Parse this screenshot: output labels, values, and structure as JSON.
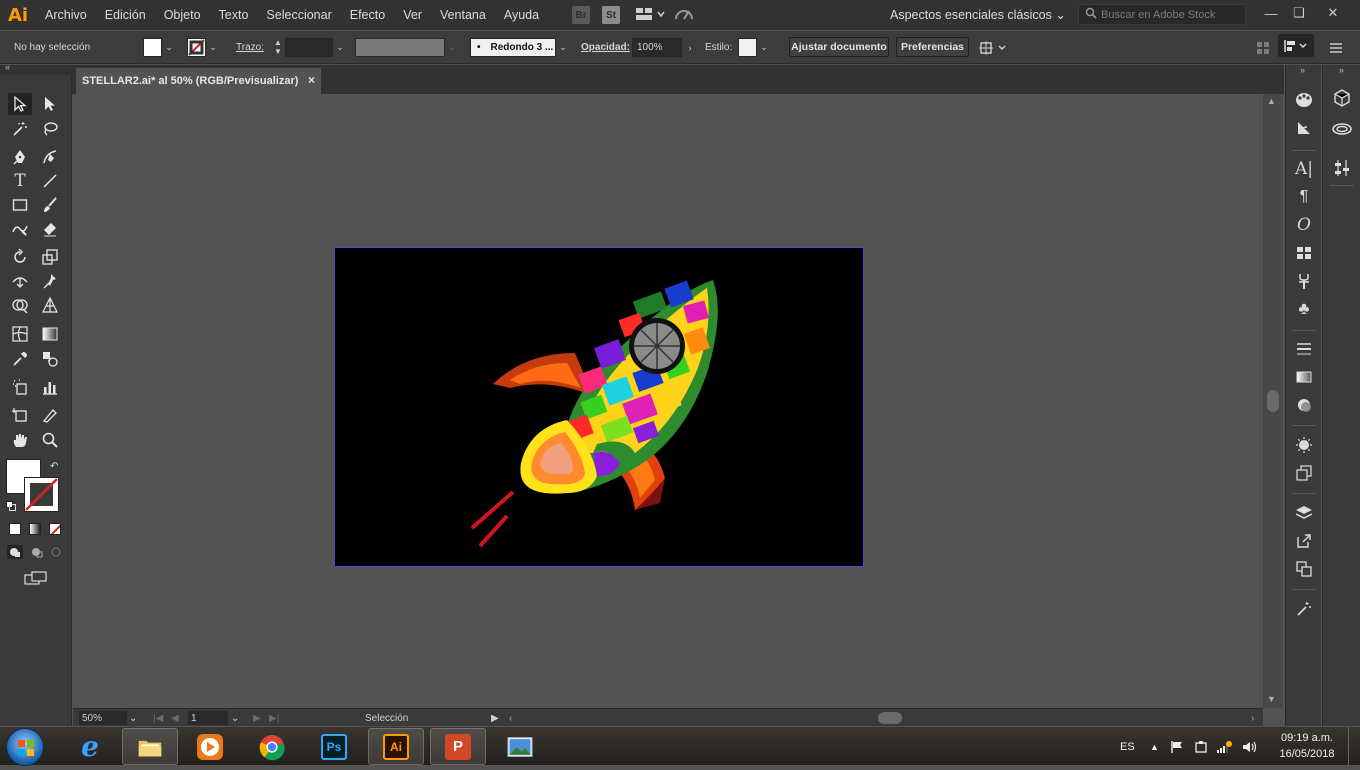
{
  "app": {
    "logo": "Ai"
  },
  "menu": [
    "Archivo",
    "Edición",
    "Objeto",
    "Texto",
    "Seleccionar",
    "Efecto",
    "Ver",
    "Ventana",
    "Ayuda"
  ],
  "bridge_buttons": [
    "Br",
    "St"
  ],
  "workspace": "Aspectos esenciales clásicos",
  "search": {
    "placeholder": "Buscar en Adobe Stock"
  },
  "control": {
    "selection": "No hay selección",
    "stroke_label": "Trazo:",
    "brush": "Redondo 3 ...",
    "brush_dot": "•",
    "opacity_label": "Opacidad:",
    "opacity_value": "100%",
    "style_label": "Estilo:",
    "fit_document": "Ajustar documento",
    "preferences": "Preferencias"
  },
  "document_tab": {
    "title": "STELLAR2.ai* al 50% (RGB/Previsualizar)",
    "close": "×"
  },
  "status": {
    "zoom": "50%",
    "artboard": "1",
    "tool": "Selección"
  },
  "taskbar": {
    "language": "ES",
    "time": "09:19 a.m.",
    "date": "16/05/2018",
    "apps": [
      {
        "name": "Internet Explorer",
        "icon": "e"
      },
      {
        "name": "Explorador de archivos",
        "icon": "folder"
      },
      {
        "name": "Reproductor",
        "icon": "play"
      },
      {
        "name": "Chrome",
        "icon": "chrome"
      },
      {
        "name": "Photoshop",
        "icon": "Ps"
      },
      {
        "name": "Illustrator",
        "icon": "Ai"
      },
      {
        "name": "PowerPoint",
        "icon": "P"
      },
      {
        "name": "Visor de fotos",
        "icon": "photo"
      }
    ]
  },
  "colors": {
    "accent": "#ff9a00",
    "artboard": "#000000",
    "canvas": "#535353"
  }
}
